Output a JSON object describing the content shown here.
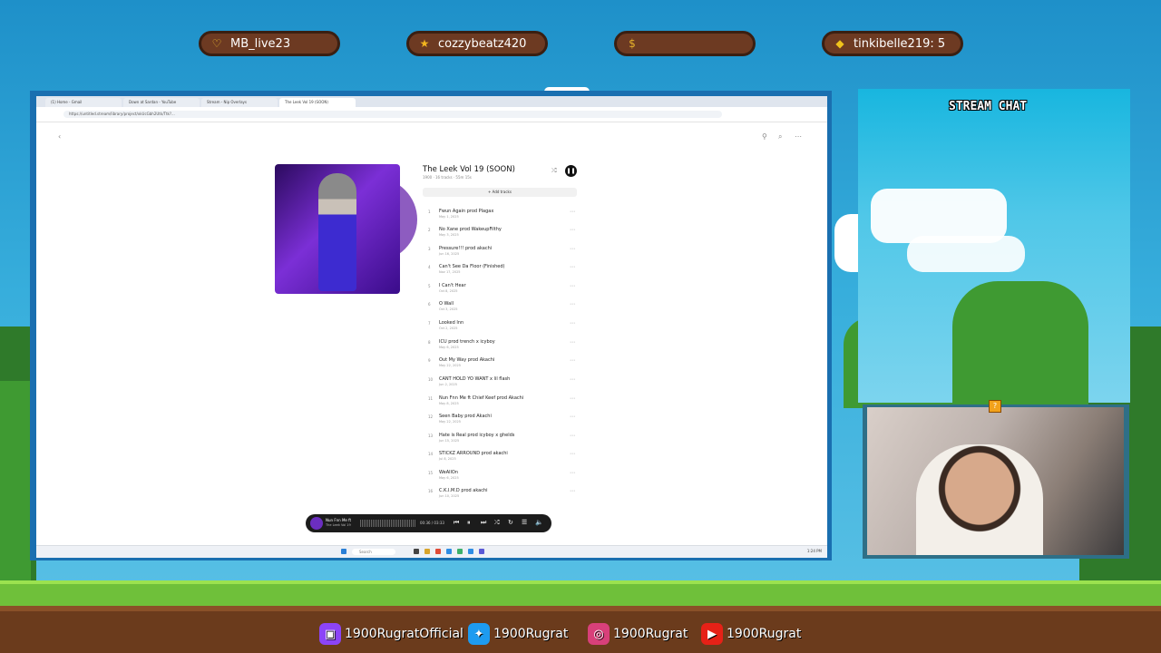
{
  "alerts": [
    {
      "icon": "heart-icon",
      "glyph": "♡",
      "color": "#f2c230",
      "text": "MB_live23"
    },
    {
      "icon": "star-icon",
      "glyph": "★",
      "color": "#f2b51e",
      "text": "cozzybeatz420"
    },
    {
      "icon": "money-bag-icon",
      "glyph": "$",
      "color": "#e5b02b",
      "text": ""
    },
    {
      "icon": "diamond-icon",
      "glyph": "◆",
      "color": "#f0c21b",
      "text": "tinkibelle219: 5"
    }
  ],
  "browser": {
    "tabs": [
      "(1) Home - Gmail",
      "Down at Sardan - YouTube",
      "Stream - Nip Overlays",
      "The Leek Vol 19 (SOON)"
    ],
    "url": "https://untitled.stream/library/project/xkUcGbh2Utk/Ttk?..."
  },
  "playlist": {
    "title": "The Leek Vol 19 (SOON)",
    "meta": "1900 · 16 tracks · 55m 15s",
    "add_tracks": "+ Add tracks",
    "tracks": [
      {
        "n": "1",
        "title": "Fwun Again prod Plagax",
        "date": "May 1, 2025"
      },
      {
        "n": "2",
        "title": "No Xane prod WakeupFilthy",
        "date": "May 3, 2025"
      },
      {
        "n": "3",
        "title": "Pressure!!! prod akachi",
        "date": "Jun 16, 2025"
      },
      {
        "n": "4",
        "title": "Can't See Da Floor (Finished)",
        "date": "Nov 17, 2025"
      },
      {
        "n": "5",
        "title": "I Can't Hear",
        "date": "Oct 8, 2025"
      },
      {
        "n": "6",
        "title": "O Wall",
        "date": "Oct 3, 2025"
      },
      {
        "n": "7",
        "title": "Looked Inn",
        "date": "Oct 2, 2025"
      },
      {
        "n": "8",
        "title": "ICU prod trench x icyboy",
        "date": "May 6, 2025"
      },
      {
        "n": "9",
        "title": "Out My Way prod Akachi",
        "date": "May 22, 2025"
      },
      {
        "n": "10",
        "title": "CANT HOLD YO WANT x lil flash",
        "date": "Jun 2, 2025"
      },
      {
        "n": "11",
        "title": "Nun Fnn Me ft Chief Keef prod Akachi",
        "date": "May 8, 2025"
      },
      {
        "n": "12",
        "title": "Seen Baby prod Akachi",
        "date": "May 22, 2025"
      },
      {
        "n": "13",
        "title": "Hate is Real prod icyboy x ghelds",
        "date": "Jun 15, 2025"
      },
      {
        "n": "14",
        "title": "STICKZ ARROUND prod akachi",
        "date": "Jul 8, 2025"
      },
      {
        "n": "15",
        "title": "WeAllOn",
        "date": "May 6, 2025"
      },
      {
        "n": "16",
        "title": "C.K.I.M.D prod akachi",
        "date": "Jun 10, 2025"
      }
    ]
  },
  "player": {
    "now_title": "Nun Fnn Me ft",
    "now_artist": "The Leek Vol 19",
    "time": "00:36 / 03:33"
  },
  "taskbar": {
    "search_placeholder": "Search",
    "clock": "1:24 PM"
  },
  "chat": {
    "title": "STREAM CHAT"
  },
  "socials": [
    {
      "icon": "twitch-icon",
      "glyph": "▣",
      "color": "#8c44f7",
      "text": "1900RugratOfficial"
    },
    {
      "icon": "twitter-icon",
      "glyph": "✦",
      "color": "#1d9bf0",
      "text": "1900Rugrat"
    },
    {
      "icon": "instagram-icon",
      "glyph": "◎",
      "color": "#d8407a",
      "text": "1900Rugrat"
    },
    {
      "icon": "youtube-icon",
      "glyph": "▶",
      "color": "#e62117",
      "text": "1900Rugrat"
    }
  ]
}
